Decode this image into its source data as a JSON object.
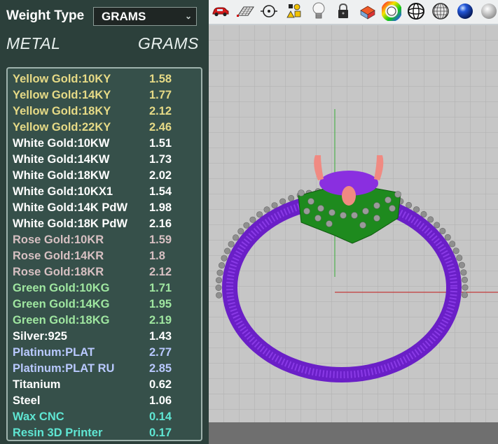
{
  "weight_type": {
    "label": "Weight Type",
    "selected": "GRAMS"
  },
  "headers": {
    "metal": "METAL",
    "grams": "GRAMS"
  },
  "rows": [
    {
      "name": "Yellow Gold:10KY",
      "value": "1.58",
      "group": "yellow"
    },
    {
      "name": "Yellow Gold:14KY",
      "value": "1.77",
      "group": "yellow"
    },
    {
      "name": "Yellow Gold:18KY",
      "value": "2.12",
      "group": "yellow"
    },
    {
      "name": "Yellow Gold:22KY",
      "value": "2.46",
      "group": "yellow"
    },
    {
      "name": "White Gold:10KW",
      "value": "1.51",
      "group": "white"
    },
    {
      "name": "White Gold:14KW",
      "value": "1.73",
      "group": "white"
    },
    {
      "name": "White Gold:18KW",
      "value": "2.02",
      "group": "white"
    },
    {
      "name": "White Gold:10KX1",
      "value": "1.54",
      "group": "white"
    },
    {
      "name": "White Gold:14K PdW",
      "value": "1.98",
      "group": "white"
    },
    {
      "name": "White Gold:18K PdW",
      "value": "2.16",
      "group": "white"
    },
    {
      "name": "Rose Gold:10KR",
      "value": "1.59",
      "group": "rose"
    },
    {
      "name": "Rose Gold:14KR",
      "value": "1.8",
      "group": "rose"
    },
    {
      "name": "Rose Gold:18KR",
      "value": "2.12",
      "group": "rose"
    },
    {
      "name": "Green Gold:10KG",
      "value": "1.71",
      "group": "green"
    },
    {
      "name": "Green Gold:14KG",
      "value": "1.95",
      "group": "green"
    },
    {
      "name": "Green Gold:18KG",
      "value": "2.19",
      "group": "green"
    },
    {
      "name": "Silver:925",
      "value": "1.43",
      "group": "white"
    },
    {
      "name": "Platinum:PLAT",
      "value": "2.77",
      "group": "plat"
    },
    {
      "name": "Platinum:PLAT RU",
      "value": "2.85",
      "group": "plat"
    },
    {
      "name": "Titanium",
      "value": "0.62",
      "group": "white"
    },
    {
      "name": "Steel",
      "value": "1.06",
      "group": "white"
    },
    {
      "name": "Wax  CNC",
      "value": "0.14",
      "group": "wax"
    },
    {
      "name": "Resin 3D Printer",
      "value": "0.17",
      "group": "wax"
    }
  ],
  "toolbar_icons": [
    "car-icon",
    "grid-plane-icon",
    "snap-target-icon",
    "shapes-icon",
    "lightbulb-icon",
    "lock-icon",
    "material-book-icon",
    "color-wheel-icon",
    "wireframe-sphere-icon",
    "mesh-sphere-icon",
    "blue-sphere-icon",
    "shaded-sphere-icon"
  ],
  "colors": {
    "panel_bg": "#2c403b",
    "list_bg": "#36504a",
    "ring_band": "#7a2ad8",
    "head_green": "#1e8a1e",
    "prong_pink": "#f08a82",
    "viewport_bg": "#c6c6c6"
  }
}
